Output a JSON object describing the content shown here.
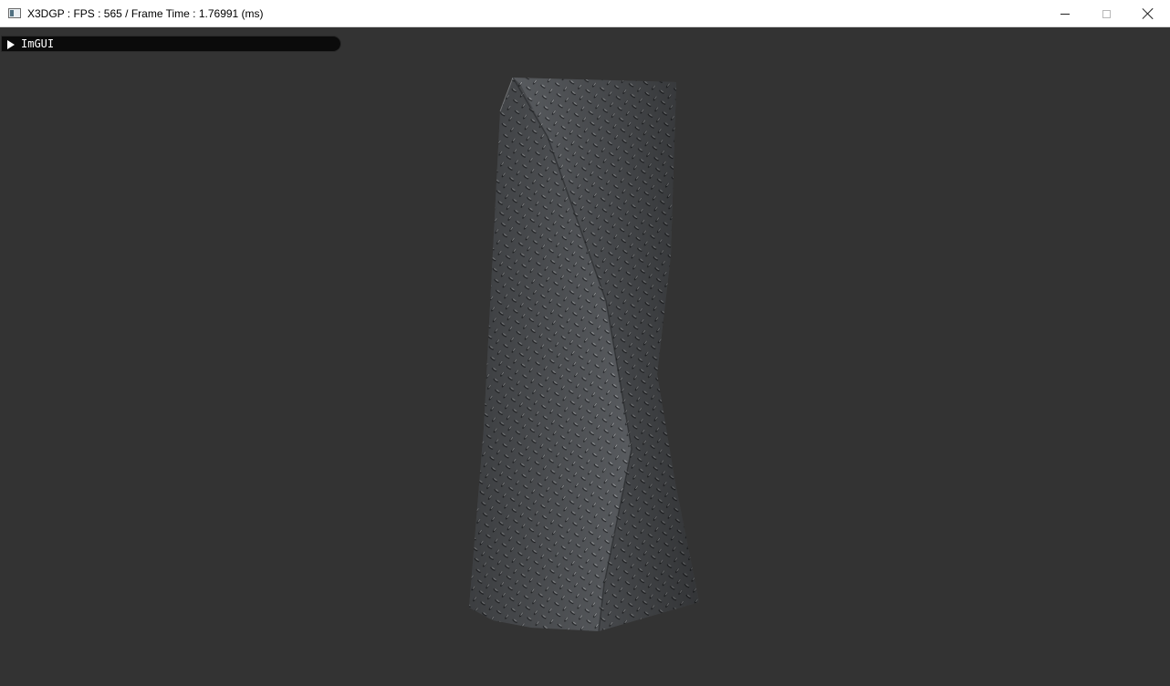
{
  "window": {
    "title": "X3DGP : FPS : 565 / Frame Time : 1.76991 (ms)",
    "icon": "app-window-icon",
    "controls": [
      "minimize",
      "maximize",
      "close"
    ]
  },
  "imgui": {
    "header_label": "ImGUI",
    "collapsed": true
  },
  "scene": {
    "background_color": "#333333",
    "object": "twisted-metal-prism",
    "texture": "diamond-plate-metal"
  }
}
